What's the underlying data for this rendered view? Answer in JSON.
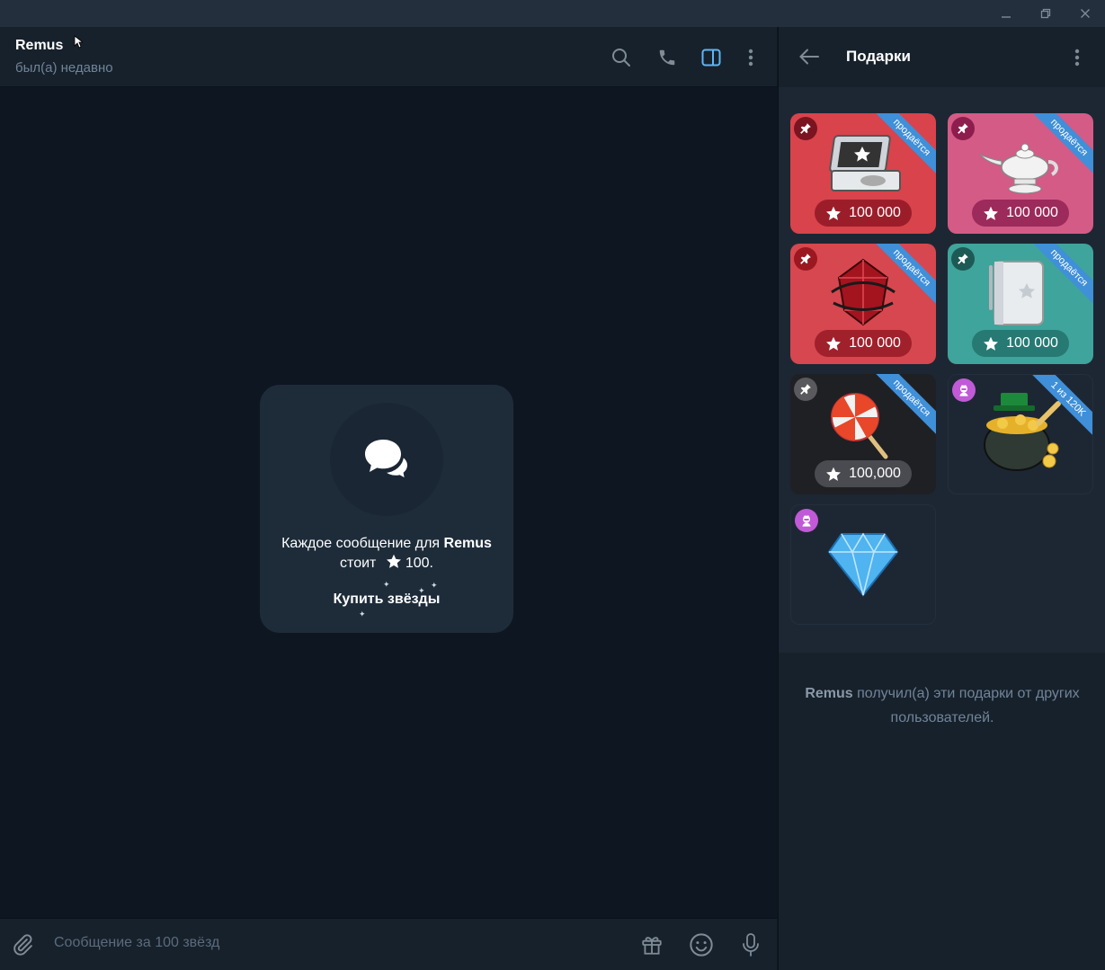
{
  "chat": {
    "peer_name": "Remus",
    "peer_status": "был(а) недавно",
    "empty_prefix": "Каждое сообщение для",
    "empty_name": "Remus",
    "empty_cost_prefix": "стоит",
    "empty_cost": "100.",
    "buy_stars": "Купить звёзды",
    "composer_placeholder": "Сообщение за 100 звёзд"
  },
  "panel": {
    "title": "Подарки",
    "footer_name": "Remus",
    "footer_text": "получил(а) эти подарки от других пользователей."
  },
  "gifts": [
    {
      "name": "case",
      "ribbon": "продаётся",
      "price": "100 000",
      "bg": "#d9434b",
      "pin_bg": "#7a1420"
    },
    {
      "name": "lamp",
      "ribbon": "продаётся",
      "price": "100 000",
      "bg": "#d35b86",
      "pin_bg": "#8d1d4c"
    },
    {
      "name": "crystal",
      "ribbon": "продаётся",
      "price": "100 000",
      "bg": "#d6474f",
      "pin_bg": "#9b1820"
    },
    {
      "name": "notebook",
      "ribbon": "продаётся",
      "price": "100 000",
      "bg": "#3fa49b",
      "pin_bg": "#1e5a55"
    },
    {
      "name": "lollipop",
      "ribbon": "продаётся",
      "price": "100,000",
      "bg": "#1f2024",
      "pin_bg": "#5a5a5e"
    },
    {
      "name": "pot-of-gold",
      "ribbon": "1 из 120K",
      "bg": "#1d2733"
    },
    {
      "name": "diamond",
      "bg": "#1d2733"
    }
  ],
  "colors": {
    "accent": "#5eb5f7",
    "app_bg": "#0e1621",
    "panel_bg": "#17212b"
  }
}
